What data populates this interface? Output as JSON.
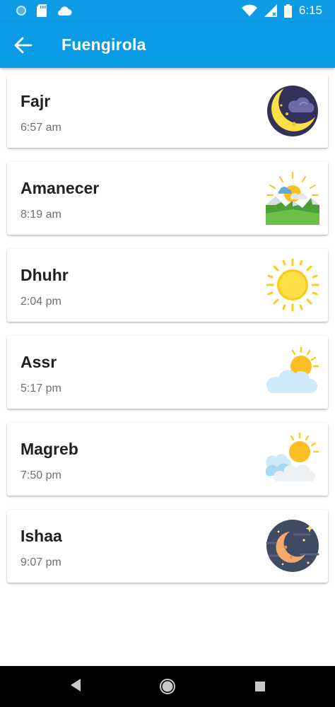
{
  "status_bar": {
    "time": "6:15",
    "icons": [
      "circle-status-icon",
      "sd-card-icon",
      "cloud-icon",
      "wifi-icon",
      "signal-icon",
      "battery-icon"
    ]
  },
  "app_bar": {
    "title": "Fuengirola",
    "back_icon": "arrow-left-icon"
  },
  "prayers": [
    {
      "name": "Fajr",
      "time": "6:57 am",
      "icon": "moon-cloud-icon"
    },
    {
      "name": "Amanecer",
      "time": "8:19 am",
      "icon": "sunrise-mountains-icon"
    },
    {
      "name": "Dhuhr",
      "time": "2:04 pm",
      "icon": "sun-icon"
    },
    {
      "name": "Assr",
      "time": "5:17 pm",
      "icon": "sun-behind-cloud-icon"
    },
    {
      "name": "Magreb",
      "time": "7:50 pm",
      "icon": "sun-behind-clouds-icon"
    },
    {
      "name": "Ishaa",
      "time": "9:07 pm",
      "icon": "night-moon-stars-icon"
    }
  ],
  "nav_bar": {
    "icons": [
      "back-triangle-icon",
      "home-circle-icon",
      "recents-square-icon"
    ]
  },
  "colors": {
    "primary": "#0b9ae6",
    "status_bar": "#0d9be6",
    "title_text": "#212121",
    "subtitle_text": "#6f6f6f"
  }
}
